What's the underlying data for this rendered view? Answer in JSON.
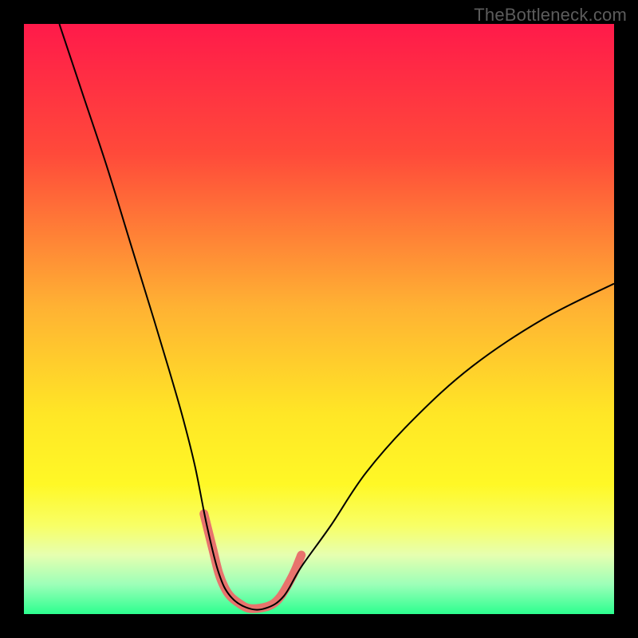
{
  "watermark": {
    "text": "TheBottleneck.com"
  },
  "chart_data": {
    "type": "line",
    "title": "",
    "xlabel": "",
    "ylabel": "",
    "xlim": [
      0,
      100
    ],
    "ylim": [
      0,
      100
    ],
    "grid": false,
    "legend": false,
    "background_gradient_stops": [
      {
        "pct": 0,
        "color": "#ff1a4a"
      },
      {
        "pct": 22,
        "color": "#ff4a3a"
      },
      {
        "pct": 48,
        "color": "#ffb233"
      },
      {
        "pct": 66,
        "color": "#ffe626"
      },
      {
        "pct": 78,
        "color": "#fff826"
      },
      {
        "pct": 85,
        "color": "#f8ff66"
      },
      {
        "pct": 90,
        "color": "#e6ffb0"
      },
      {
        "pct": 95,
        "color": "#9cffb8"
      },
      {
        "pct": 100,
        "color": "#2cff8f"
      }
    ],
    "series": [
      {
        "name": "bottleneck-curve",
        "color": "#000000",
        "stroke_width": 2,
        "x": [
          6,
          10,
          14,
          18,
          22,
          25,
          27,
          29,
          31,
          33,
          35,
          38,
          41,
          44,
          47,
          52,
          58,
          66,
          76,
          88,
          100
        ],
        "y": [
          100,
          88,
          76,
          63,
          50,
          40,
          33,
          25,
          15,
          7,
          3,
          1,
          1,
          3,
          8,
          15,
          24,
          33,
          42,
          50,
          56
        ]
      },
      {
        "name": "highlight-valley",
        "color": "#e8736d",
        "stroke_width": 11,
        "linecap": "round",
        "x": [
          30.5,
          32,
          33,
          34,
          35,
          36.5,
          38,
          40,
          42,
          43.5,
          45,
          46,
          47
        ],
        "y": [
          17,
          11,
          7,
          4.5,
          3,
          1.8,
          1,
          1,
          1.6,
          3,
          5.5,
          7.5,
          10
        ]
      }
    ],
    "annotations": []
  }
}
